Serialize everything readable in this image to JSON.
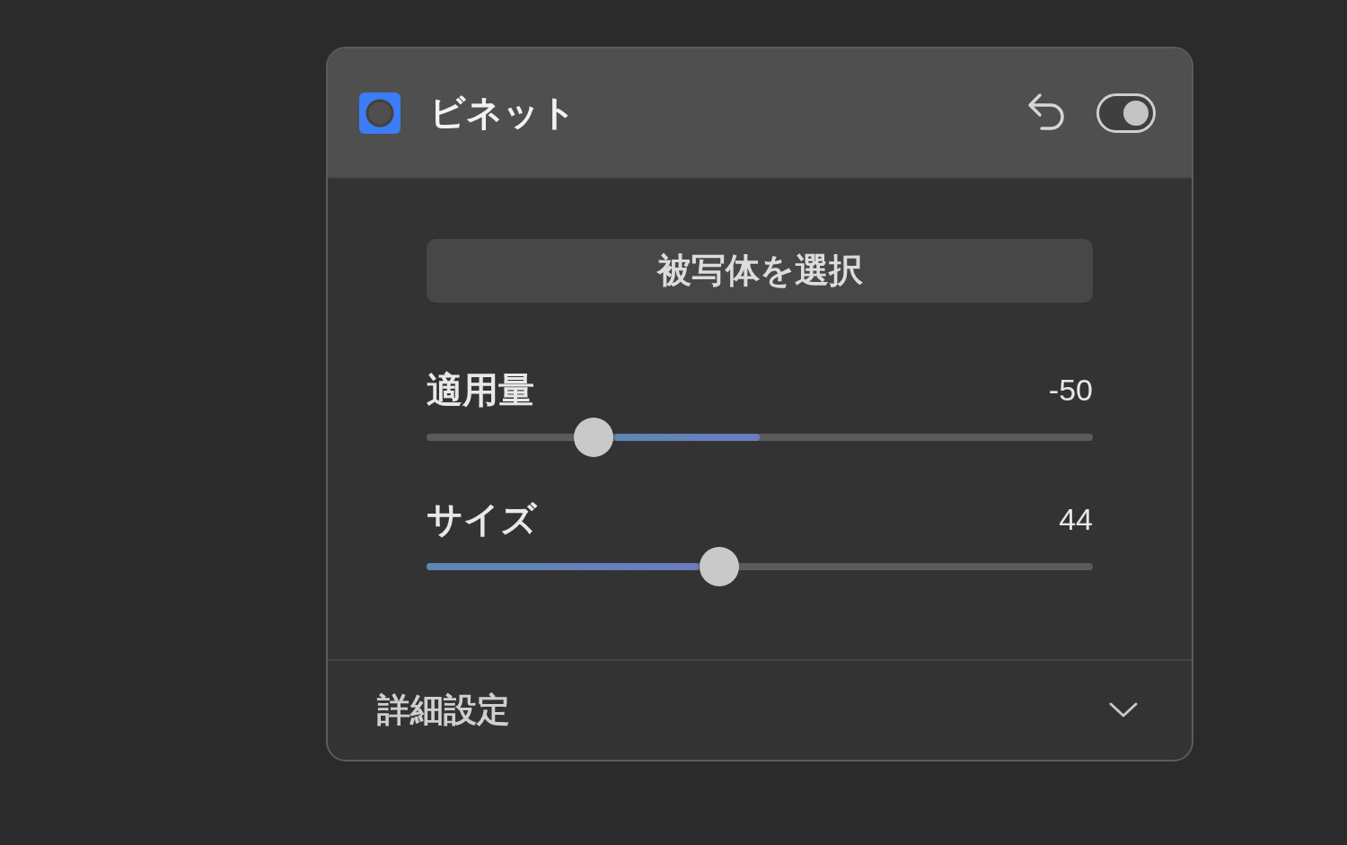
{
  "panel": {
    "title": "ビネット",
    "enabled": true
  },
  "subject_button": {
    "label": "被写体を選択"
  },
  "sliders": [
    {
      "kind": "bipolar",
      "label": "適用量",
      "reading": "-50",
      "level": 0.25
    },
    {
      "kind": "standard",
      "label": "サイズ",
      "reading": "44",
      "level": 0.44
    }
  ],
  "advanced": {
    "label": "詳細設定",
    "expanded": false
  }
}
